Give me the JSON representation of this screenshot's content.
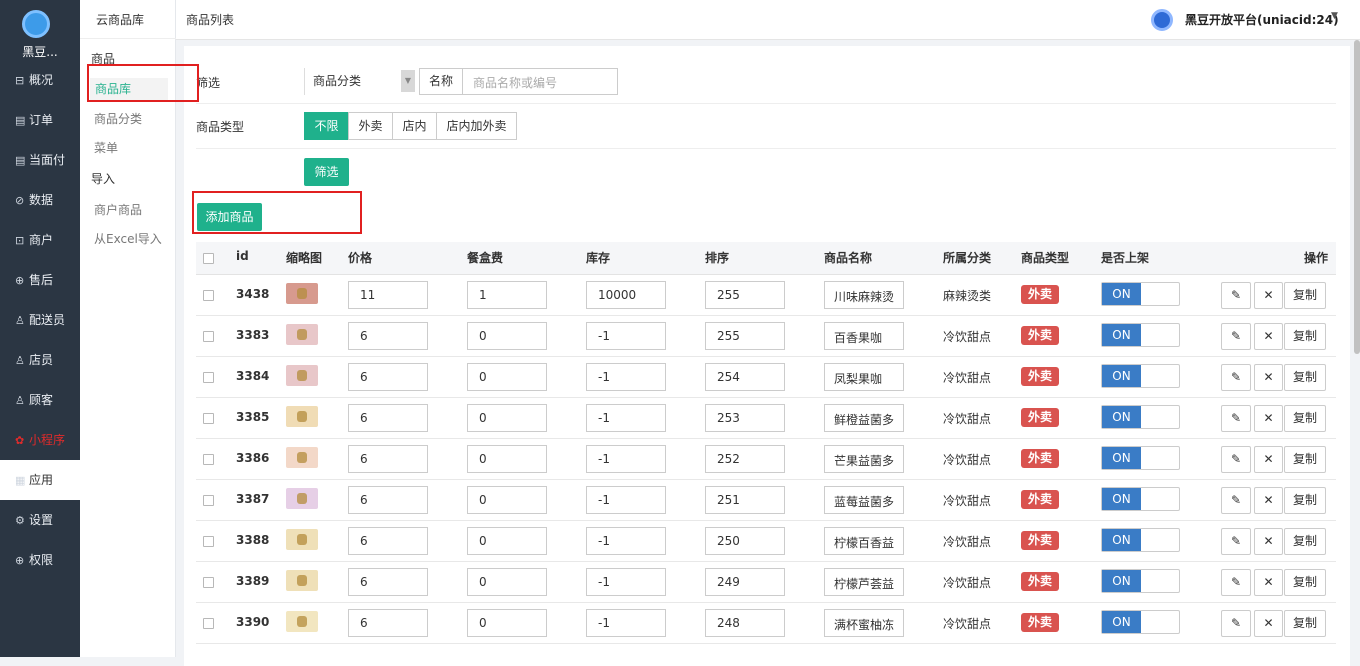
{
  "nav": {
    "brand": "黑豆...",
    "items": [
      {
        "label": "概况",
        "icon": "dashboard-icon"
      },
      {
        "label": "订单",
        "icon": "order-icon"
      },
      {
        "label": "当面付",
        "icon": "payment-icon"
      },
      {
        "label": "数据",
        "icon": "data-icon"
      },
      {
        "label": "商户",
        "icon": "store-icon"
      },
      {
        "label": "售后",
        "icon": "aftersale-icon"
      },
      {
        "label": "配送员",
        "icon": "courier-icon"
      },
      {
        "label": "店员",
        "icon": "staff-icon"
      },
      {
        "label": "顾客",
        "icon": "customer-icon"
      },
      {
        "label": "小程序",
        "icon": "miniprogram-icon"
      },
      {
        "label": "应用",
        "icon": "apps-icon"
      },
      {
        "label": "设置",
        "icon": "settings-icon"
      },
      {
        "label": "权限",
        "icon": "lock-icon"
      }
    ]
  },
  "subnav": {
    "title": "云商品库",
    "group1": "商品",
    "items1": [
      "商品库",
      "商品分类",
      "菜单"
    ],
    "group2": "导入",
    "items2": [
      "商户商品",
      "从Excel导入"
    ]
  },
  "header": {
    "title": "商品列表",
    "account": "黑豆开放平台(uniacid:24)"
  },
  "filter": {
    "label": "筛选",
    "category_select": "商品分类",
    "name_label": "名称",
    "name_placeholder": "商品名称或编号",
    "type_label": "商品类型",
    "type_options": [
      "不限",
      "外卖",
      "店内",
      "店内加外卖"
    ],
    "submit": "筛选"
  },
  "add_button": "添加商品",
  "table": {
    "headers": [
      "id",
      "缩略图",
      "价格",
      "餐盒费",
      "库存",
      "排序",
      "商品名称",
      "所属分类",
      "商品类型",
      "是否上架",
      "操作"
    ],
    "toggle_on": "ON",
    "copy_label": "复制",
    "rows": [
      {
        "id": "3438",
        "price": "11",
        "box_fee": "1",
        "stock": "10000",
        "sort": "255",
        "name": "川味麻辣烫",
        "category": "麻辣烫类",
        "type": "外卖"
      },
      {
        "id": "3383",
        "price": "6",
        "box_fee": "0",
        "stock": "-1",
        "sort": "255",
        "name": "百香果咖",
        "category": "冷饮甜点",
        "type": "外卖"
      },
      {
        "id": "3384",
        "price": "6",
        "box_fee": "0",
        "stock": "-1",
        "sort": "254",
        "name": "凤梨果咖",
        "category": "冷饮甜点",
        "type": "外卖"
      },
      {
        "id": "3385",
        "price": "6",
        "box_fee": "0",
        "stock": "-1",
        "sort": "253",
        "name": "鲜橙益菌多",
        "category": "冷饮甜点",
        "type": "外卖"
      },
      {
        "id": "3386",
        "price": "6",
        "box_fee": "0",
        "stock": "-1",
        "sort": "252",
        "name": "芒果益菌多",
        "category": "冷饮甜点",
        "type": "外卖"
      },
      {
        "id": "3387",
        "price": "6",
        "box_fee": "0",
        "stock": "-1",
        "sort": "251",
        "name": "蓝莓益菌多",
        "category": "冷饮甜点",
        "type": "外卖"
      },
      {
        "id": "3388",
        "price": "6",
        "box_fee": "0",
        "stock": "-1",
        "sort": "250",
        "name": "柠檬百香益",
        "category": "冷饮甜点",
        "type": "外卖"
      },
      {
        "id": "3389",
        "price": "6",
        "box_fee": "0",
        "stock": "-1",
        "sort": "249",
        "name": "柠檬芦荟益",
        "category": "冷饮甜点",
        "type": "外卖"
      },
      {
        "id": "3390",
        "price": "6",
        "box_fee": "0",
        "stock": "-1",
        "sort": "248",
        "name": "满杯蜜柚冻",
        "category": "冷饮甜点",
        "type": "外卖"
      }
    ]
  }
}
